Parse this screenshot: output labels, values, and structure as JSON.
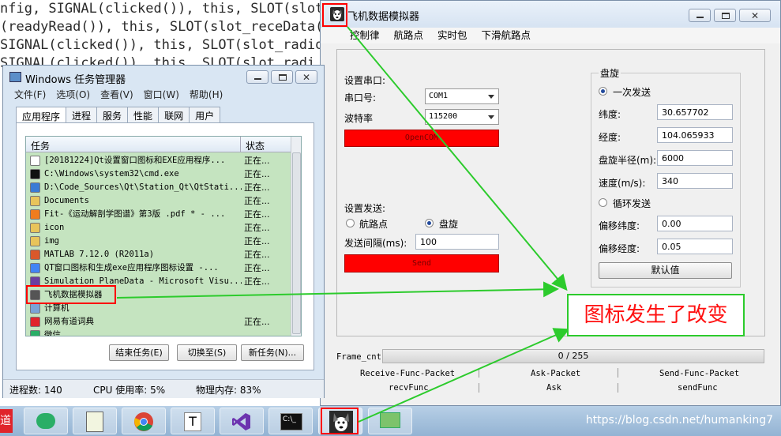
{
  "code_lines": [
    "nfig, SIGNAL(clicked()), this, SLOT(slot_C",
    "(readyRead()), this, SLOT(slot_receData(",
    "SIGNAL(clicked()), this, SLOT(slot_radioC",
    "SIGNAL(clicked()), this, SLOT(slot_radi"
  ],
  "sim": {
    "title": "飞机数据模拟器",
    "menu": [
      "控制律",
      "航路点",
      "实时包",
      "下滑航路点"
    ],
    "serial_header": "设置串口:",
    "port_label": "串口号:",
    "port_value": "COM1",
    "baud_label": "波特率",
    "baud_value": "115200",
    "open_btn": "OpenCOM",
    "send_header": "设置发送:",
    "radio_waypoint": "航路点",
    "radio_hover": "盘旋",
    "interval_label": "发送间隔(ms):",
    "interval_value": "100",
    "send_btn": "Send",
    "group_title": "盘旋",
    "once_label": "一次发送",
    "lat_label": "纬度:",
    "lat_value": "30.657702",
    "lon_label": "经度:",
    "lon_value": "104.065933",
    "radius_label": "盘旋半径(m):",
    "radius_value": "6000",
    "speed_label": "速度(m/s):",
    "speed_value": "340",
    "loop_label": "循环发送",
    "off_lat_label": "偏移纬度:",
    "off_lat_value": "0.00",
    "off_lon_label": "偏移经度:",
    "off_lon_value": "0.05",
    "default_btn": "默认值",
    "frame_label": "Frame_cnt",
    "frame_value": "0 / 255",
    "packets": [
      "Receive-Func-Packet",
      "Ask-Packet",
      "Send-Func-Packet"
    ],
    "funcs": [
      "recvFunc",
      "Ask",
      "sendFunc"
    ]
  },
  "tm": {
    "title": "Windows 任务管理器",
    "menu": [
      "文件(F)",
      "选项(O)",
      "查看(V)",
      "窗口(W)",
      "帮助(H)"
    ],
    "tabs": [
      "应用程序",
      "进程",
      "服务",
      "性能",
      "联网",
      "用户"
    ],
    "col_task": "任务",
    "col_status": "状态",
    "rows": [
      {
        "name": "[20181224]Qt设置窗口图标和EXE应用程序...",
        "status": "正在...",
        "color": "#ffffff"
      },
      {
        "name": "C:\\Windows\\system32\\cmd.exe",
        "status": "正在...",
        "color": "#111111"
      },
      {
        "name": "D:\\Code_Sources\\Qt\\Station_Qt\\QtStati...",
        "status": "正在...",
        "color": "#3a7bd5"
      },
      {
        "name": "Documents",
        "status": "正在...",
        "color": "#e8c45a"
      },
      {
        "name": "Fit-《运动解剖学图谱》第3版 .pdf * - ...",
        "status": "正在...",
        "color": "#f07c1e"
      },
      {
        "name": "icon",
        "status": "正在...",
        "color": "#e8c45a"
      },
      {
        "name": "img",
        "status": "正在...",
        "color": "#e8c45a"
      },
      {
        "name": "MATLAB  7.12.0 (R2011a)",
        "status": "正在...",
        "color": "#d9582b"
      },
      {
        "name": "QT窗口图标和生成exe应用程序图标设置 -...",
        "status": "正在...",
        "color": "#4285f4"
      },
      {
        "name": "Simulation_PlaneData - Microsoft Visu...",
        "status": "正在...",
        "color": "#6b3fa0"
      },
      {
        "name": "飞机数据模拟器",
        "status": "",
        "color": "#555555"
      },
      {
        "name": "计算机",
        "status": "",
        "color": "#7aa3d6"
      },
      {
        "name": "网易有道词典",
        "status": "正在...",
        "color": "#e0242b"
      },
      {
        "name": "微信",
        "status": "",
        "color": "#2aae67"
      }
    ],
    "btn_end": "结束任务(E)",
    "btn_switch": "切换至(S)",
    "btn_new": "新任务(N)...",
    "foot_proc": "进程数: 140",
    "foot_cpu": "CPU 使用率: 5%",
    "foot_mem": "物理内存: 83%"
  },
  "annotation": "图标发生了改变",
  "watermark": "https://blog.csdn.net/humanking7",
  "taskbar_badge": "道",
  "colors": {
    "accent_red": "#ff0000",
    "arrow_green": "#2ccb2c",
    "list_green": "#c5e4c0"
  }
}
